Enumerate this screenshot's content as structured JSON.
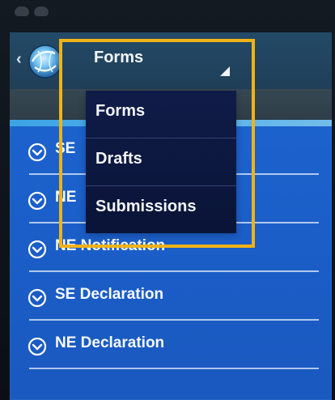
{
  "header": {
    "selected_form_type": "Forms"
  },
  "dropdown": {
    "items": [
      {
        "label": "Forms"
      },
      {
        "label": "Drafts"
      },
      {
        "label": "Submissions"
      }
    ]
  },
  "list": {
    "items": [
      {
        "label": "SE"
      },
      {
        "label": "NE"
      },
      {
        "label": "NE Notification"
      },
      {
        "label": "SE Declaration"
      },
      {
        "label": "NE Declaration"
      }
    ]
  },
  "colors": {
    "highlight": "#f0b316",
    "list_background": "#1d65d0",
    "dropdown_background": "#101c48"
  },
  "icons": {
    "back": "chevron-left-icon",
    "logo": "globe-logo-icon",
    "spinner": "dropdown-triangle-icon",
    "list_item": "expand-circle-icon"
  }
}
